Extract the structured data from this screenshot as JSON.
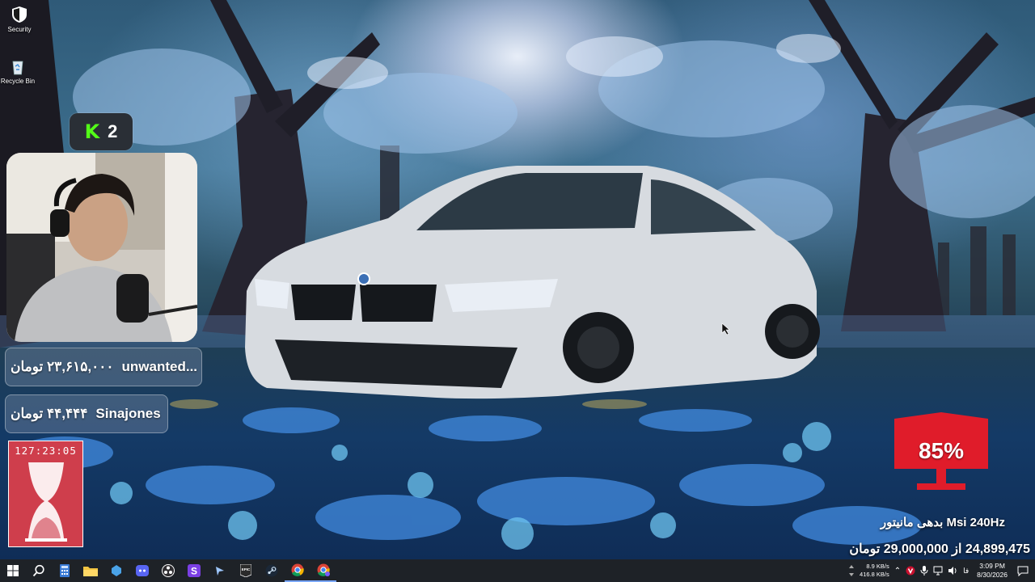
{
  "desktop": {
    "icons": [
      {
        "label": "Security",
        "icon": "shield-icon"
      },
      {
        "label": "Recycle Bin",
        "icon": "recycle-bin-icon"
      }
    ]
  },
  "overlay": {
    "kick": {
      "icon": "kick-logo-icon",
      "viewers": "2"
    },
    "donations": [
      {
        "amount": "۲۳,۶۱۵,۰۰۰ تومان",
        "name": "unwanted..."
      },
      {
        "amount": "۴۴,۴۴۴ تومان",
        "name": "Sinajones"
      }
    ],
    "timer": "127:23:05",
    "goal": {
      "percent": "85%",
      "title": "Msi 240Hz بدهی مانیتور",
      "amount_line": "24,899,475 از 29,000,000 تومان",
      "progress": 0.85
    }
  },
  "taskbar": {
    "apps": [
      "windows-start-icon",
      "search-icon",
      "calculator-icon",
      "file-explorer-icon",
      "app-blue-icon",
      "discord-icon",
      "obs-icon",
      "stremio-s-icon",
      "app-arrow-icon",
      "epic-games-icon",
      "steam-icon",
      "chrome-icon",
      "chrome-profile-icon"
    ],
    "tray": {
      "upload": "8.9 KB/s",
      "download": "416.8 KB/s",
      "language": "فا",
      "time": "3:09 PM",
      "date": "8/30/2026"
    }
  }
}
